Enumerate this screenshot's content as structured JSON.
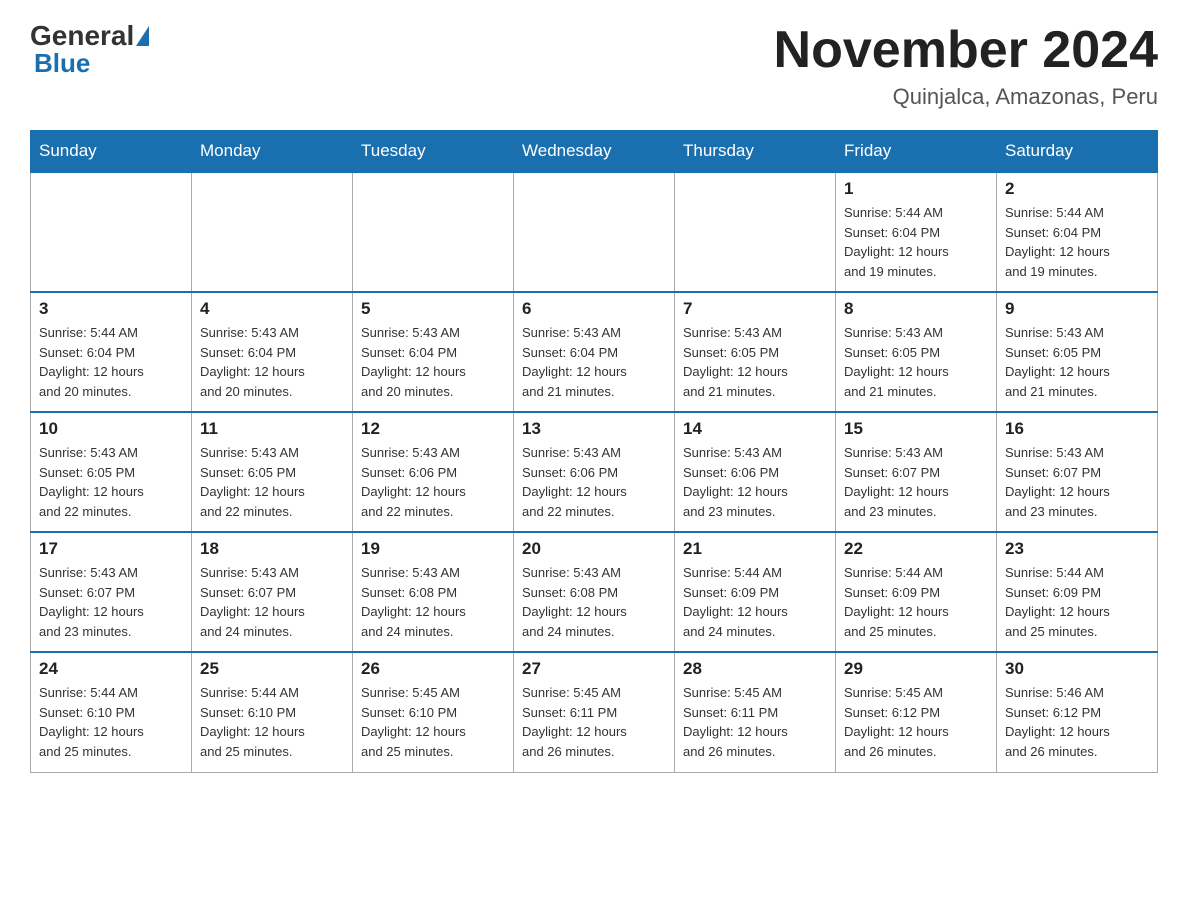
{
  "header": {
    "logo_general": "General",
    "logo_blue": "Blue",
    "month_title": "November 2024",
    "location": "Quinjalca, Amazonas, Peru"
  },
  "weekdays": [
    "Sunday",
    "Monday",
    "Tuesday",
    "Wednesday",
    "Thursday",
    "Friday",
    "Saturday"
  ],
  "weeks": [
    [
      {
        "day": "",
        "info": ""
      },
      {
        "day": "",
        "info": ""
      },
      {
        "day": "",
        "info": ""
      },
      {
        "day": "",
        "info": ""
      },
      {
        "day": "",
        "info": ""
      },
      {
        "day": "1",
        "info": "Sunrise: 5:44 AM\nSunset: 6:04 PM\nDaylight: 12 hours\nand 19 minutes."
      },
      {
        "day": "2",
        "info": "Sunrise: 5:44 AM\nSunset: 6:04 PM\nDaylight: 12 hours\nand 19 minutes."
      }
    ],
    [
      {
        "day": "3",
        "info": "Sunrise: 5:44 AM\nSunset: 6:04 PM\nDaylight: 12 hours\nand 20 minutes."
      },
      {
        "day": "4",
        "info": "Sunrise: 5:43 AM\nSunset: 6:04 PM\nDaylight: 12 hours\nand 20 minutes."
      },
      {
        "day": "5",
        "info": "Sunrise: 5:43 AM\nSunset: 6:04 PM\nDaylight: 12 hours\nand 20 minutes."
      },
      {
        "day": "6",
        "info": "Sunrise: 5:43 AM\nSunset: 6:04 PM\nDaylight: 12 hours\nand 21 minutes."
      },
      {
        "day": "7",
        "info": "Sunrise: 5:43 AM\nSunset: 6:05 PM\nDaylight: 12 hours\nand 21 minutes."
      },
      {
        "day": "8",
        "info": "Sunrise: 5:43 AM\nSunset: 6:05 PM\nDaylight: 12 hours\nand 21 minutes."
      },
      {
        "day": "9",
        "info": "Sunrise: 5:43 AM\nSunset: 6:05 PM\nDaylight: 12 hours\nand 21 minutes."
      }
    ],
    [
      {
        "day": "10",
        "info": "Sunrise: 5:43 AM\nSunset: 6:05 PM\nDaylight: 12 hours\nand 22 minutes."
      },
      {
        "day": "11",
        "info": "Sunrise: 5:43 AM\nSunset: 6:05 PM\nDaylight: 12 hours\nand 22 minutes."
      },
      {
        "day": "12",
        "info": "Sunrise: 5:43 AM\nSunset: 6:06 PM\nDaylight: 12 hours\nand 22 minutes."
      },
      {
        "day": "13",
        "info": "Sunrise: 5:43 AM\nSunset: 6:06 PM\nDaylight: 12 hours\nand 22 minutes."
      },
      {
        "day": "14",
        "info": "Sunrise: 5:43 AM\nSunset: 6:06 PM\nDaylight: 12 hours\nand 23 minutes."
      },
      {
        "day": "15",
        "info": "Sunrise: 5:43 AM\nSunset: 6:07 PM\nDaylight: 12 hours\nand 23 minutes."
      },
      {
        "day": "16",
        "info": "Sunrise: 5:43 AM\nSunset: 6:07 PM\nDaylight: 12 hours\nand 23 minutes."
      }
    ],
    [
      {
        "day": "17",
        "info": "Sunrise: 5:43 AM\nSunset: 6:07 PM\nDaylight: 12 hours\nand 23 minutes."
      },
      {
        "day": "18",
        "info": "Sunrise: 5:43 AM\nSunset: 6:07 PM\nDaylight: 12 hours\nand 24 minutes."
      },
      {
        "day": "19",
        "info": "Sunrise: 5:43 AM\nSunset: 6:08 PM\nDaylight: 12 hours\nand 24 minutes."
      },
      {
        "day": "20",
        "info": "Sunrise: 5:43 AM\nSunset: 6:08 PM\nDaylight: 12 hours\nand 24 minutes."
      },
      {
        "day": "21",
        "info": "Sunrise: 5:44 AM\nSunset: 6:09 PM\nDaylight: 12 hours\nand 24 minutes."
      },
      {
        "day": "22",
        "info": "Sunrise: 5:44 AM\nSunset: 6:09 PM\nDaylight: 12 hours\nand 25 minutes."
      },
      {
        "day": "23",
        "info": "Sunrise: 5:44 AM\nSunset: 6:09 PM\nDaylight: 12 hours\nand 25 minutes."
      }
    ],
    [
      {
        "day": "24",
        "info": "Sunrise: 5:44 AM\nSunset: 6:10 PM\nDaylight: 12 hours\nand 25 minutes."
      },
      {
        "day": "25",
        "info": "Sunrise: 5:44 AM\nSunset: 6:10 PM\nDaylight: 12 hours\nand 25 minutes."
      },
      {
        "day": "26",
        "info": "Sunrise: 5:45 AM\nSunset: 6:10 PM\nDaylight: 12 hours\nand 25 minutes."
      },
      {
        "day": "27",
        "info": "Sunrise: 5:45 AM\nSunset: 6:11 PM\nDaylight: 12 hours\nand 26 minutes."
      },
      {
        "day": "28",
        "info": "Sunrise: 5:45 AM\nSunset: 6:11 PM\nDaylight: 12 hours\nand 26 minutes."
      },
      {
        "day": "29",
        "info": "Sunrise: 5:45 AM\nSunset: 6:12 PM\nDaylight: 12 hours\nand 26 minutes."
      },
      {
        "day": "30",
        "info": "Sunrise: 5:46 AM\nSunset: 6:12 PM\nDaylight: 12 hours\nand 26 minutes."
      }
    ]
  ]
}
